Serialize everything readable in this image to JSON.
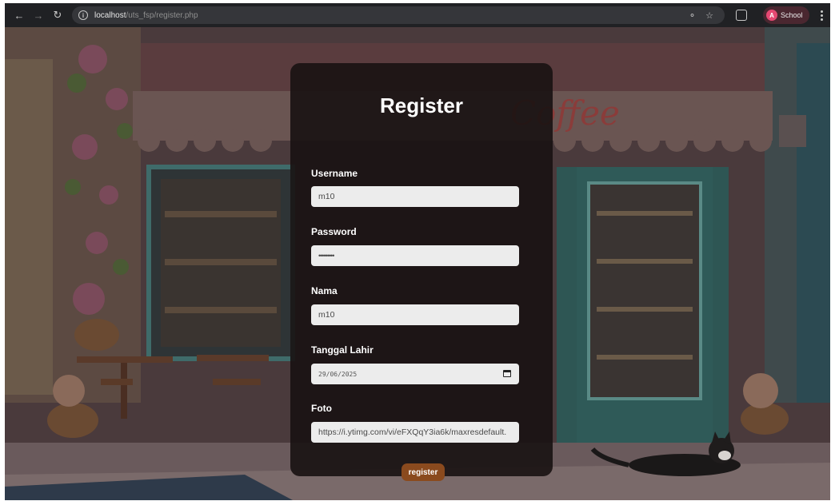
{
  "browser": {
    "url_host": "localhost",
    "url_path": "/uts_fsp/register.php",
    "profile_name": "School",
    "profile_initial": "A",
    "nav_icons": [
      "back-icon",
      "forward-icon",
      "reload-icon"
    ],
    "omnibox_icons": [
      "site-info-icon",
      "translate-icon",
      "bookmark-star-icon"
    ]
  },
  "background": {
    "sign_text": "Coffee"
  },
  "form": {
    "title": "Register",
    "fields": [
      {
        "label": "Username",
        "type": "text",
        "value": "m10"
      },
      {
        "label": "Password",
        "type": "password",
        "value": "•••••••••"
      },
      {
        "label": "Nama",
        "type": "text",
        "value": "m10"
      },
      {
        "label": "Tanggal Lahir",
        "type": "date",
        "value": "29/06/2025"
      },
      {
        "label": "Foto",
        "type": "url",
        "value": "https://i.ytimg.com/vi/eFXQqY3ia6k/maxresdefault."
      }
    ],
    "submit_label": "register"
  },
  "colors": {
    "card_bg": "#181212",
    "input_bg": "#ececec",
    "button_bg": "#8a4a1e",
    "profile_avatar": "#e64872"
  }
}
